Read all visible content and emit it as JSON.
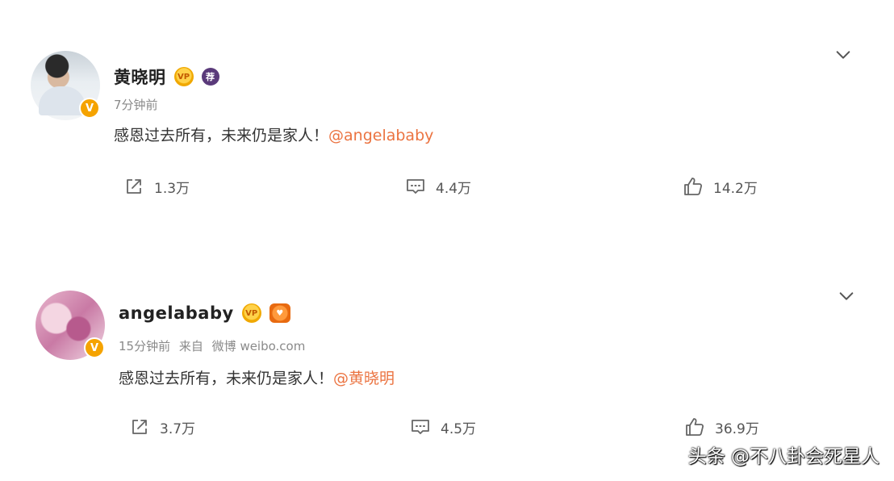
{
  "posts": [
    {
      "name": "黄晓明",
      "time": "7分钟前",
      "source_prefix": "",
      "source": "",
      "text": "感恩过去所有，未来仍是家人！",
      "mention": "@angelababy",
      "actions": {
        "share": "1.3万",
        "comment": "4.4万",
        "like": "14.2万"
      }
    },
    {
      "name": "angelababy",
      "time": "15分钟前",
      "source_prefix": "来自",
      "source": "微博 weibo.com",
      "text": "感恩过去所有，未来仍是家人！",
      "mention": "@黄晓明",
      "actions": {
        "share": "3.7万",
        "comment": "4.5万",
        "like": "36.9万"
      }
    }
  ],
  "watermark": "头条 @不八卦会死星人",
  "colors": {
    "mention": "#eb7340",
    "verified_badge": "#f5a300"
  },
  "icons": [
    "chevron-down-icon",
    "share-icon",
    "comment-icon",
    "like-icon",
    "verified-badge-icon"
  ]
}
